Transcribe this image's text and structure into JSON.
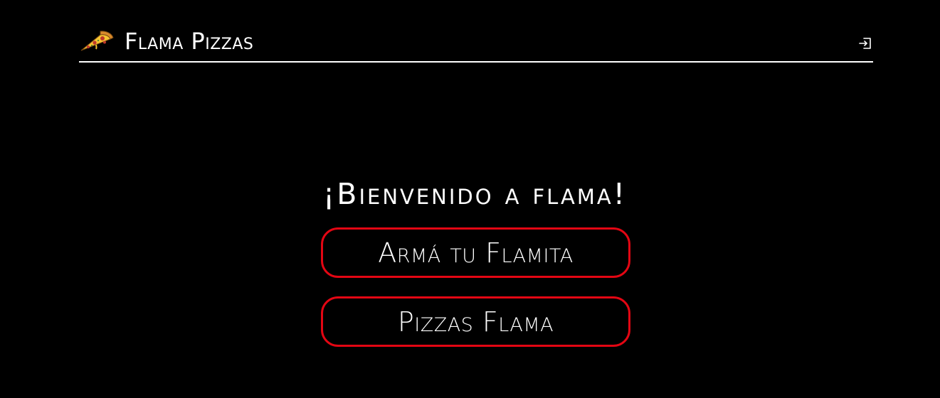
{
  "header": {
    "brand_name": "Flama Pizzas",
    "brand_icon": "pizza-slice-icon",
    "login_icon": "login-icon"
  },
  "main": {
    "welcome": "¡Bienvenido a flama!",
    "buttons": [
      {
        "label": "Armá tu Flamita"
      },
      {
        "label": "Pizzas Flama"
      }
    ]
  },
  "colors": {
    "background": "#000000",
    "text": "#ffffff",
    "accent_border": "#e30613"
  }
}
